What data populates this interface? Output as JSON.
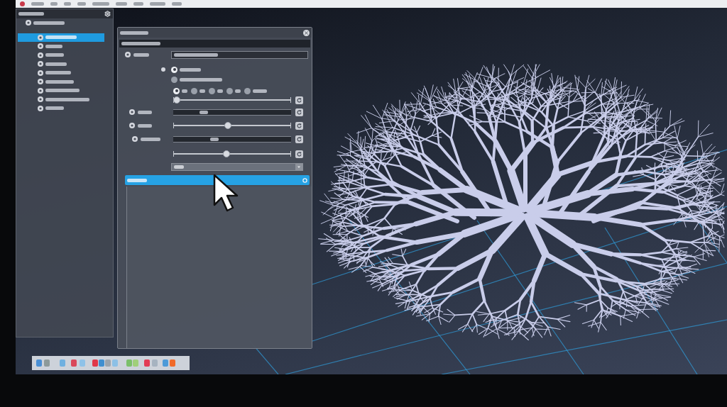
{
  "tree": [
    {
      "selected": false,
      "children": [
        {
          "selected": true
        },
        {
          "selected": false
        },
        {
          "selected": false
        },
        {
          "selected": false
        },
        {
          "selected": false
        },
        {
          "selected": false
        },
        {
          "selected": false
        },
        {
          "selected": false
        },
        {
          "selected": false
        }
      ]
    }
  ],
  "dialog": {
    "options": [
      {
        "selected": true
      },
      {
        "selected": false
      }
    ],
    "choices": [
      {
        "selected": true
      },
      {
        "selected": false
      },
      {
        "selected": false
      },
      {
        "selected": false
      },
      {
        "selected": false
      }
    ],
    "controls": [
      {
        "kind": "slider",
        "level": 0
      },
      {
        "kind": "field"
      },
      {
        "kind": "slider",
        "level": 0.46
      },
      {
        "kind": "field"
      },
      {
        "kind": "slider",
        "level": 0.45
      }
    ],
    "section": {
      "selected": true
    }
  }
}
